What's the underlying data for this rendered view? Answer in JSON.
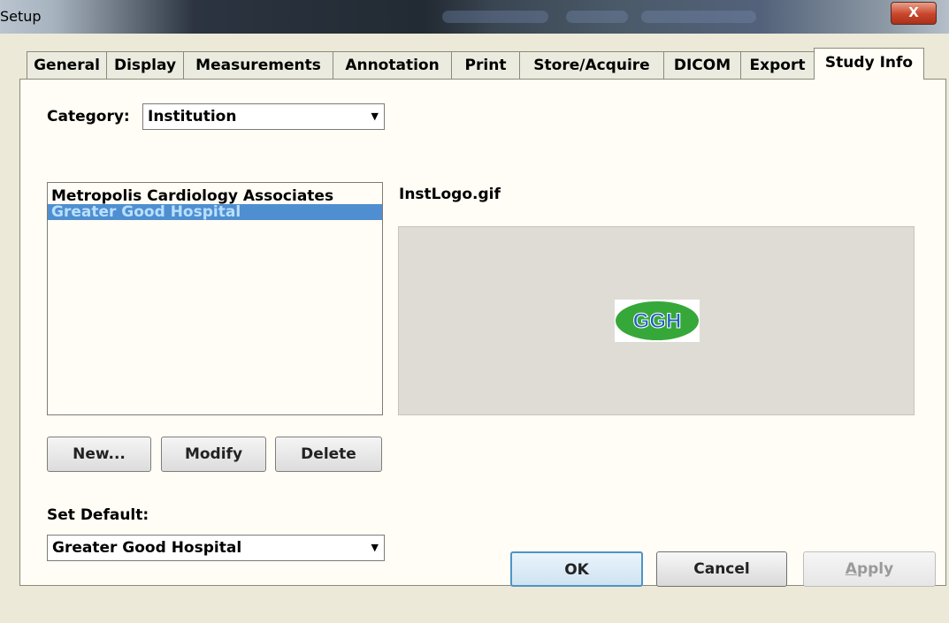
{
  "window": {
    "title": "Setup",
    "close_glyph": "X"
  },
  "tabs": [
    {
      "label": "General"
    },
    {
      "label": "Display"
    },
    {
      "label": "Measurements"
    },
    {
      "label": "Annotation"
    },
    {
      "label": "Print"
    },
    {
      "label": "Store/Acquire"
    },
    {
      "label": "DICOM"
    },
    {
      "label": "Export"
    },
    {
      "label": "Study Info",
      "active": true
    }
  ],
  "category": {
    "label": "Category:",
    "value": "Institution"
  },
  "institutions": {
    "items": [
      {
        "label": "Metropolis Cardiology Associates",
        "selected": false
      },
      {
        "label": "Greater Good Hospital",
        "selected": true
      }
    ]
  },
  "logo": {
    "filename": "InstLogo.gif",
    "text": "GGH"
  },
  "list_buttons": {
    "new": "New...",
    "modify": "Modify",
    "delete": "Delete"
  },
  "set_default": {
    "label": "Set Default:",
    "value": "Greater Good Hospital"
  },
  "footer": {
    "ok": "OK",
    "cancel": "Cancel",
    "apply_prefix": "A",
    "apply_rest": "pply"
  }
}
